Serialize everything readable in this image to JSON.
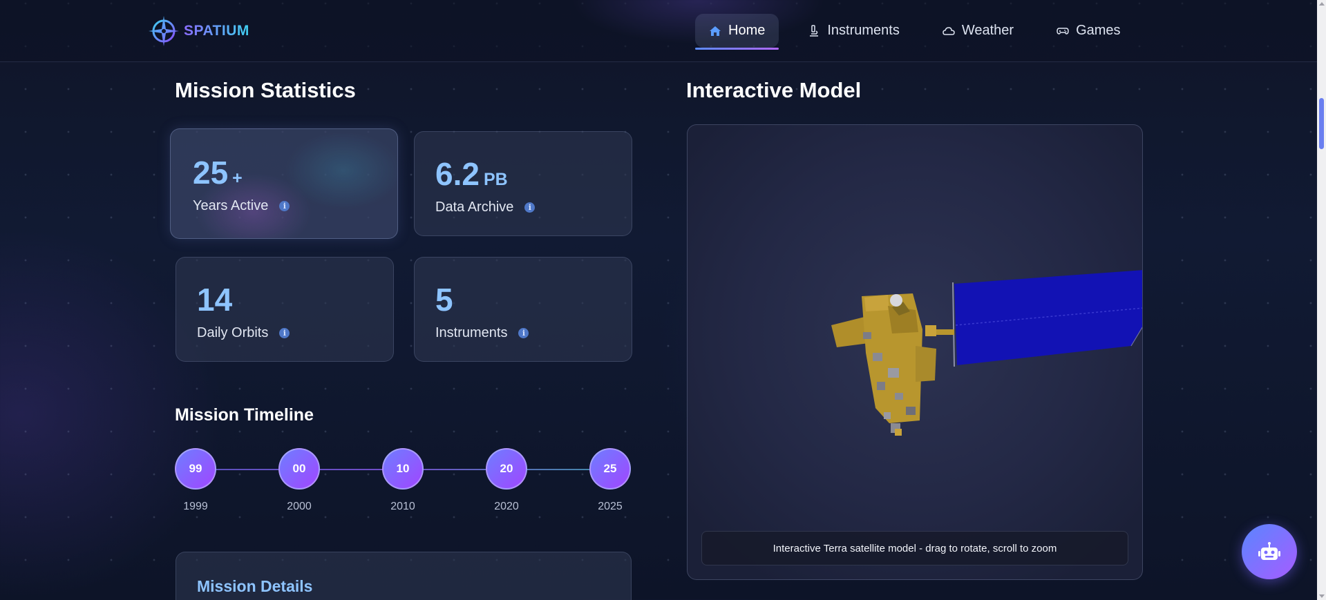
{
  "brand": {
    "name": "SPATIUM",
    "logo_icon": "compass-star-icon"
  },
  "nav": {
    "items": [
      {
        "label": "Home",
        "icon": "home-icon",
        "active": true
      },
      {
        "label": "Instruments",
        "icon": "microscope-icon",
        "active": false
      },
      {
        "label": "Weather",
        "icon": "cloud-icon",
        "active": false
      },
      {
        "label": "Games",
        "icon": "gamepad-icon",
        "active": false
      }
    ]
  },
  "stats": {
    "title": "Mission Statistics",
    "cards": [
      {
        "value": "25",
        "unit": "+",
        "label": "Years Active"
      },
      {
        "value": "6.2",
        "unit": "PB",
        "label": "Data Archive"
      },
      {
        "value": "14",
        "unit": "",
        "label": "Daily Orbits"
      },
      {
        "value": "5",
        "unit": "",
        "label": "Instruments"
      }
    ]
  },
  "timeline": {
    "title": "Mission Timeline",
    "nodes": [
      {
        "short": "99",
        "year": "1999"
      },
      {
        "short": "00",
        "year": "2000"
      },
      {
        "short": "10",
        "year": "2010"
      },
      {
        "short": "20",
        "year": "2020"
      },
      {
        "short": "25",
        "year": "2025"
      }
    ]
  },
  "details": {
    "title": "Mission Details"
  },
  "model": {
    "title": "Interactive Model",
    "caption": "Interactive Terra satellite model - drag to rotate, scroll to zoom"
  },
  "chatbot": {
    "icon": "robot-icon"
  },
  "colors": {
    "accent": "#8ec4ff",
    "timeline_start": "#6f7dff",
    "timeline_end": "#a046ff",
    "solar_panel": "#1010b0",
    "satellite_body": "#b8962e"
  }
}
